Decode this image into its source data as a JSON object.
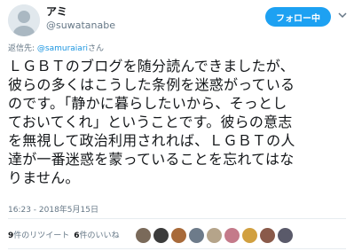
{
  "user": {
    "display_name": "アミ",
    "handle": "@suwatanabe"
  },
  "follow_button": {
    "label": "フォロー中"
  },
  "reply": {
    "prefix": "返信先: ",
    "mention": "@samuraiari",
    "suffix": "さん"
  },
  "tweet": {
    "lines": [
      "ＬＧＢＴのブログを随分読んできましたが、",
      "彼らの多くはこうした条例を迷惑がっている",
      "のです。「静かに暮らしたいから、そっとし",
      "ておいてくれ」ということです。彼らの意志",
      "を無視して政治利用されれば、ＬＧＢＴの人",
      "達が一番迷惑を蒙っていることを忘れてはな",
      "りません。"
    ]
  },
  "timestamp": "16:23 - 2018年5月15日",
  "stats": {
    "retweet_count": "9",
    "retweet_label": "件のリツイート",
    "like_count": "6",
    "like_label": "件のいいね"
  },
  "likers": [
    {
      "color": "#7a6a5a"
    },
    {
      "color": "#3b3b3b"
    },
    {
      "color": "#a86a3a"
    },
    {
      "color": "#6d7b8a"
    },
    {
      "color": "#b5a48a"
    },
    {
      "color": "#c47a8a"
    },
    {
      "color": "#d1a040"
    },
    {
      "color": "#8a5a4a"
    },
    {
      "color": "#5a5a6a"
    }
  ],
  "colors": {
    "accent": "#1da1f2",
    "link": "#1b95e0",
    "muted": "#657786"
  }
}
